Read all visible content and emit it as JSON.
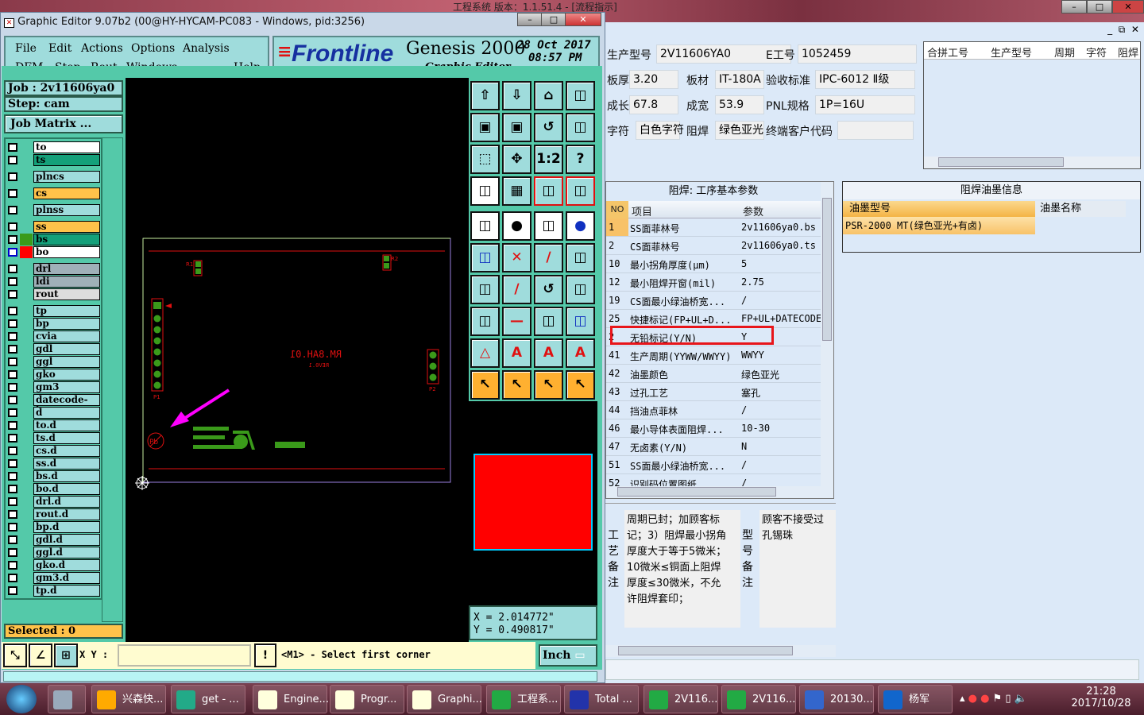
{
  "desktop": {
    "right_window_title": "工程系统   版本：1.1.51.4 - [流程指示]"
  },
  "genesis": {
    "title": "Graphic Editor 9.07b2 (00@HY-HYCAM-PC083 - Windows, pid:3256)",
    "menu": [
      "File",
      "Edit",
      "Actions",
      "Options",
      "Analysis",
      "DFM",
      "Step",
      "Rout",
      "Windows",
      "Help"
    ],
    "brand": "Frontline",
    "product": "Genesis 2000",
    "subtitle": "Graphic Editor",
    "date": "28 Oct 2017",
    "time": "08:57 PM",
    "job": "Job : 2v11606ya0",
    "step": "Step: cam",
    "job_matrix": "Job Matrix ...",
    "layers": [
      {
        "name": "to",
        "color": "#ffffff"
      },
      {
        "name": "ts",
        "color": "#14a07a"
      },
      {
        "name": "plncs",
        "color": "#9fdcdc"
      },
      {
        "name": "cs",
        "color": "#ffc24a"
      },
      {
        "name": "plnss",
        "color": "#9fdcdc"
      },
      {
        "name": "ss",
        "color": "#ffc24a"
      },
      {
        "name": "bs",
        "color": "#14a07a"
      },
      {
        "name": "bo",
        "color": "#ffffff"
      },
      {
        "name": "drl",
        "color": "#9fb0b8"
      },
      {
        "name": "ldi",
        "color": "#9fb0b8"
      },
      {
        "name": "rout",
        "color": "#dcdcdc"
      },
      {
        "name": "tp"
      },
      {
        "name": "bp"
      },
      {
        "name": "cvia"
      },
      {
        "name": "gdl"
      },
      {
        "name": "ggl"
      },
      {
        "name": "gko"
      },
      {
        "name": "gm3"
      },
      {
        "name": "datecode-bs"
      },
      {
        "name": "d"
      },
      {
        "name": "to.d"
      },
      {
        "name": "ts.d"
      },
      {
        "name": "cs.d"
      },
      {
        "name": "ss.d"
      },
      {
        "name": "bs.d"
      },
      {
        "name": "bo.d"
      },
      {
        "name": "drl.d"
      },
      {
        "name": "rout.d"
      },
      {
        "name": "bp.d"
      },
      {
        "name": "gdl.d"
      },
      {
        "name": "ggl.d"
      },
      {
        "name": "gko.d"
      },
      {
        "name": "gm3.d"
      },
      {
        "name": "tp.d"
      }
    ],
    "selected": "Selected : 0",
    "coord_x": "X = 2.014772\"",
    "coord_y": "Y = 0.490817\"",
    "xy_label": "X Y :",
    "xy_value": "",
    "prompt": "<M1> - Select first corner",
    "units": "Inch",
    "board_text": [
      "RM.8AH.01",
      "REV0.1",
      "P1",
      "P2",
      "R1",
      "R2",
      "Pb"
    ],
    "toolbar": [
      "zoom-home-icon",
      "zoom-page-icon",
      "home-icon",
      "window-xy-icon",
      "pan-left-icon",
      "pan-right-icon",
      "undo-view-icon",
      "redraw-icon",
      "fit-icon",
      "center-icon",
      "scale-1-2-icon",
      "help-icon",
      "measure-icon",
      "grid-icon",
      "snap-icon",
      "snap2-icon",
      "fill-icon",
      "outline-icon",
      "ruler-icon",
      "point-icon",
      "connect-icon",
      "cross-icon",
      "line-icon",
      "arc-icon",
      "angle-icon",
      "slash-icon",
      "rotate-icon",
      "mirror-icon",
      "add-icon",
      "minus-icon",
      "dim-icon",
      "group-icon",
      "triangle-icon",
      "arrow-a-icon",
      "text-a-icon",
      "text-a2-icon",
      "select-icon",
      "select-box-icon",
      "select-poly-icon",
      "select-net-icon"
    ]
  },
  "app": {
    "form": [
      {
        "label": "生产型号",
        "value": "2V11606YA0"
      },
      {
        "label": "E工号",
        "value": "1052459"
      },
      {
        "label": "板厚",
        "value": "3.20"
      },
      {
        "label": "板材",
        "value": "IT-180A"
      },
      {
        "label": "验收标准",
        "value": "IPC-6012 Ⅱ级"
      },
      {
        "label": "成长",
        "value": "67.8"
      },
      {
        "label": "成宽",
        "value": "53.9"
      },
      {
        "label": "PNL规格",
        "value": "1P=16U"
      },
      {
        "label": "字符",
        "value": "白色字符"
      },
      {
        "label": "阻焊",
        "value": "绿色亚光"
      },
      {
        "label": "终端客户代码",
        "value": ""
      }
    ],
    "merge_grid_headers": [
      "合拼工号",
      "生产型号",
      "周期",
      "字符",
      "阻焊"
    ],
    "params_title": "阻焊: 工序基本参数",
    "params_headers": [
      "NO",
      "项目",
      "参数"
    ],
    "params": [
      [
        "1",
        "SS面菲林号",
        "2v11606ya0.bs"
      ],
      [
        "2",
        "CS面菲林号",
        "2v11606ya0.ts"
      ],
      [
        "10",
        "最小拐角厚度(μm)",
        "5"
      ],
      [
        "12",
        "最小阻焊开窗(mil)",
        "2.75"
      ],
      [
        "19",
        "CS面最小绿油桥宽...",
        "/"
      ],
      [
        "25",
        "快捷标记(FP+UL+D...",
        "FP+UL+DATECODE"
      ],
      [
        "2",
        "无铅标记(Y/N)",
        "Y"
      ],
      [
        "41",
        "生产周期(YYWW/WWYY)",
        "WWYY"
      ],
      [
        "42",
        "油墨颜色",
        "绿色亚光"
      ],
      [
        "43",
        "过孔工艺",
        "塞孔"
      ],
      [
        "44",
        "挡油点菲林",
        "/"
      ],
      [
        "46",
        "最小导体表面阻焊...",
        "10-30"
      ],
      [
        "47",
        "无卤素(Y/N)",
        "N"
      ],
      [
        "51",
        "SS面最小绿油桥宽...",
        "/"
      ],
      [
        "52",
        "识别码位置图纸",
        "/"
      ]
    ],
    "ink_title": "阻焊油墨信息",
    "ink_headers": [
      "油墨型号",
      "油墨名称"
    ],
    "ink_rows": [
      [
        "PSR-2000 MT(绿色亚光+有卤)",
        ""
      ]
    ],
    "process_note_label": "工艺备注",
    "process_note": "周期已封；加顾客标记；3）阻焊最小拐角厚度大于等于5微米；10微米≤铜面上阻焊厚度≤30微米，不允许阻焊套印；",
    "model_note_label": "型号备注",
    "model_note": "顾客不接受过孔锡珠"
  },
  "taskbar": {
    "items": [
      "",
      "",
      "兴森快...",
      "get - ...",
      "Engine...",
      "Progr...",
      "Graphi...",
      "工程系...",
      "Total ...",
      "2V116...",
      "2V116...",
      "20130...",
      "杨军"
    ],
    "time": "21:28",
    "date": "2017/10/28"
  },
  "colors": {
    "teal": "#54c9a9",
    "panel": "#9fdcdc",
    "highlight": "#e8151a",
    "arrow": "#ff00ff"
  }
}
